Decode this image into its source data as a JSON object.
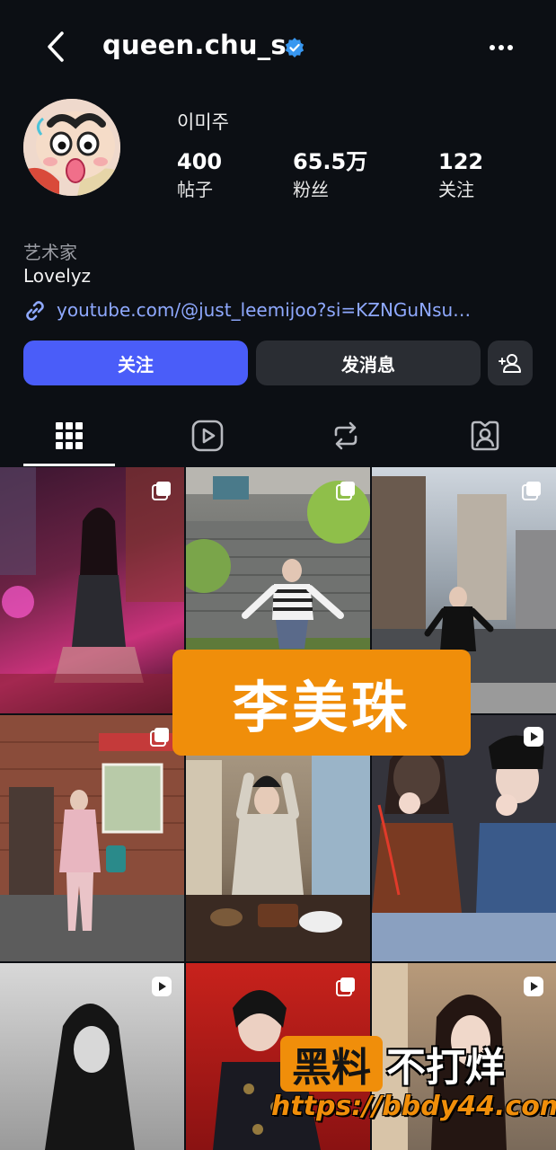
{
  "header": {
    "username": "queen.chu_s",
    "back_icon": "chevron-left-icon",
    "verified_icon": "verified-badge-icon",
    "more_icon": "more-horizontal-icon",
    "verified_color": "#3897f0"
  },
  "profile": {
    "display_name": "이미주",
    "stats": [
      {
        "value": "400",
        "label": "帖子"
      },
      {
        "value": "65.5万",
        "label": "粉丝"
      },
      {
        "value": "122",
        "label": "关注"
      }
    ],
    "category": "艺术家",
    "bio": "Lovelyz",
    "link": "youtube.com/@just_leemijoo?si=KZNGuNsu…"
  },
  "actions": {
    "follow": "关注",
    "message": "发消息",
    "add_user_icon": "add-user-icon",
    "follow_color": "#4a5df9"
  },
  "tabs": [
    {
      "icon": "grid-icon",
      "active": true
    },
    {
      "icon": "reels-icon",
      "active": false
    },
    {
      "icon": "repost-icon",
      "active": false
    },
    {
      "icon": "tagged-icon",
      "active": false
    }
  ],
  "overlay": {
    "name_banner": "李美珠",
    "watermark_box": "黑料",
    "watermark_text": "不打烊",
    "watermark_url": "https://bbdy44.com",
    "accent": "#f08e0a"
  }
}
